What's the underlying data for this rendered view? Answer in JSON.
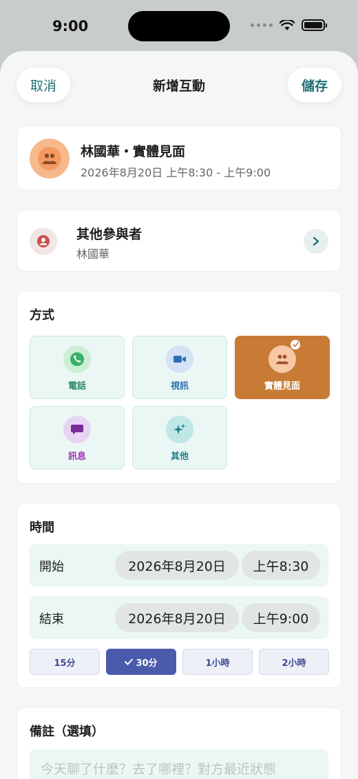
{
  "status": {
    "time": "9:00"
  },
  "nav": {
    "cancel": "取消",
    "title": "新增互動",
    "save": "儲存"
  },
  "summary": {
    "title": "林國華・實體見面",
    "subtitle": "2026年8月20日 上午8:30 - 上午9:00"
  },
  "participants": {
    "title": "其他參與者",
    "names": "林國華"
  },
  "method": {
    "title": "方式",
    "options": [
      {
        "label": "電話",
        "icon": "phone-icon",
        "color": "#2f8a63",
        "active": false
      },
      {
        "label": "視訊",
        "icon": "video-icon",
        "color": "#2e6fb2",
        "active": false
      },
      {
        "label": "實體見面",
        "icon": "people-icon",
        "color": "#ffffff",
        "active": true
      },
      {
        "label": "訊息",
        "icon": "message-icon",
        "color": "#a336b8",
        "active": false
      },
      {
        "label": "其他",
        "icon": "sparkle-icon",
        "color": "#1f7f8a",
        "active": false
      }
    ]
  },
  "time": {
    "title": "時間",
    "start": {
      "label": "開始",
      "date": "2026年8月20日",
      "time": "上午8:30"
    },
    "end": {
      "label": "結束",
      "date": "2026年8月20日",
      "time": "上午9:00"
    },
    "durations": [
      {
        "label": "15分",
        "active": false
      },
      {
        "label": "30分",
        "active": true
      },
      {
        "label": "1小時",
        "active": false
      },
      {
        "label": "2小時",
        "active": false
      }
    ]
  },
  "notes": {
    "title": "備註（選填）",
    "placeholder": "今天聊了什麼？去了哪裡？對方最近狀態"
  },
  "colors": {
    "accent": "#1f6f73",
    "active_method": "#c77b34",
    "active_duration": "#4b5bab"
  }
}
